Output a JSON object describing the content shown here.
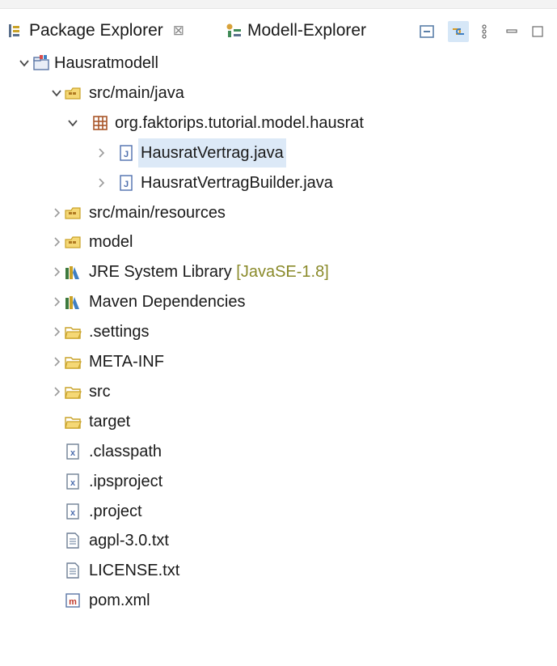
{
  "colors": {
    "selection": "#dce9f7",
    "decoration": "#8a8a2a",
    "package_icon": "#c9a227",
    "folder_icon": "#d4aa2b",
    "java_icon": "#4e6fae"
  },
  "view": {
    "tabs": [
      {
        "label": "Package Explorer",
        "icon": "package-explorer-icon",
        "close": "⊠"
      },
      {
        "label": "Modell-Explorer",
        "icon": "model-explorer-icon"
      }
    ],
    "toolbar": [
      {
        "icon": "collapse-all-icon"
      },
      {
        "icon": "link-with-editor-icon"
      },
      {
        "icon": "view-menu-icon"
      },
      {
        "icon": "minimize-icon"
      },
      {
        "icon": "maximize-icon"
      }
    ]
  },
  "tree": {
    "items": [
      {
        "label": "Hausratmodell",
        "icon": "project-icon",
        "depth": 0,
        "state": "expanded"
      },
      {
        "label": "src/main/java",
        "icon": "source-folder-icon",
        "depth": 1,
        "state": "expanded"
      },
      {
        "label": "org.faktorips.tutorial.model.hausrat",
        "icon": "package-icon",
        "depth": 2,
        "state": "expanded"
      },
      {
        "label": "HausratVertrag.java",
        "icon": "java-file-icon",
        "depth": 3,
        "state": "collapsed",
        "selected": true
      },
      {
        "label": "HausratVertragBuilder.java",
        "icon": "java-file-icon",
        "depth": 3,
        "state": "collapsed"
      },
      {
        "label": "src/main/resources",
        "icon": "source-folder-icon",
        "depth": 1,
        "state": "collapsed"
      },
      {
        "label": "model",
        "icon": "source-folder-icon",
        "depth": 1,
        "state": "collapsed"
      },
      {
        "label": "JRE System Library",
        "decoration": "[JavaSE-1.8]",
        "icon": "library-icon",
        "depth": 1,
        "state": "collapsed"
      },
      {
        "label": "Maven Dependencies",
        "icon": "library-icon",
        "depth": 1,
        "state": "collapsed"
      },
      {
        "label": ".settings",
        "icon": "folder-icon",
        "depth": 1,
        "state": "collapsed"
      },
      {
        "label": "META-INF",
        "icon": "folder-icon",
        "depth": 1,
        "state": "collapsed"
      },
      {
        "label": "src",
        "icon": "folder-icon",
        "depth": 1,
        "state": "collapsed"
      },
      {
        "label": "target",
        "icon": "folder-icon",
        "depth": 1,
        "state": "leaf"
      },
      {
        "label": ".classpath",
        "icon": "xml-file-icon",
        "depth": 1,
        "state": "leaf"
      },
      {
        "label": ".ipsproject",
        "icon": "xml-file-icon",
        "depth": 1,
        "state": "leaf"
      },
      {
        "label": ".project",
        "icon": "xml-file-icon",
        "depth": 1,
        "state": "leaf"
      },
      {
        "label": "agpl-3.0.txt",
        "icon": "text-file-icon",
        "depth": 1,
        "state": "leaf"
      },
      {
        "label": "LICENSE.txt",
        "icon": "text-file-icon",
        "depth": 1,
        "state": "leaf"
      },
      {
        "label": "pom.xml",
        "icon": "maven-pom-icon",
        "depth": 1,
        "state": "leaf"
      }
    ]
  }
}
